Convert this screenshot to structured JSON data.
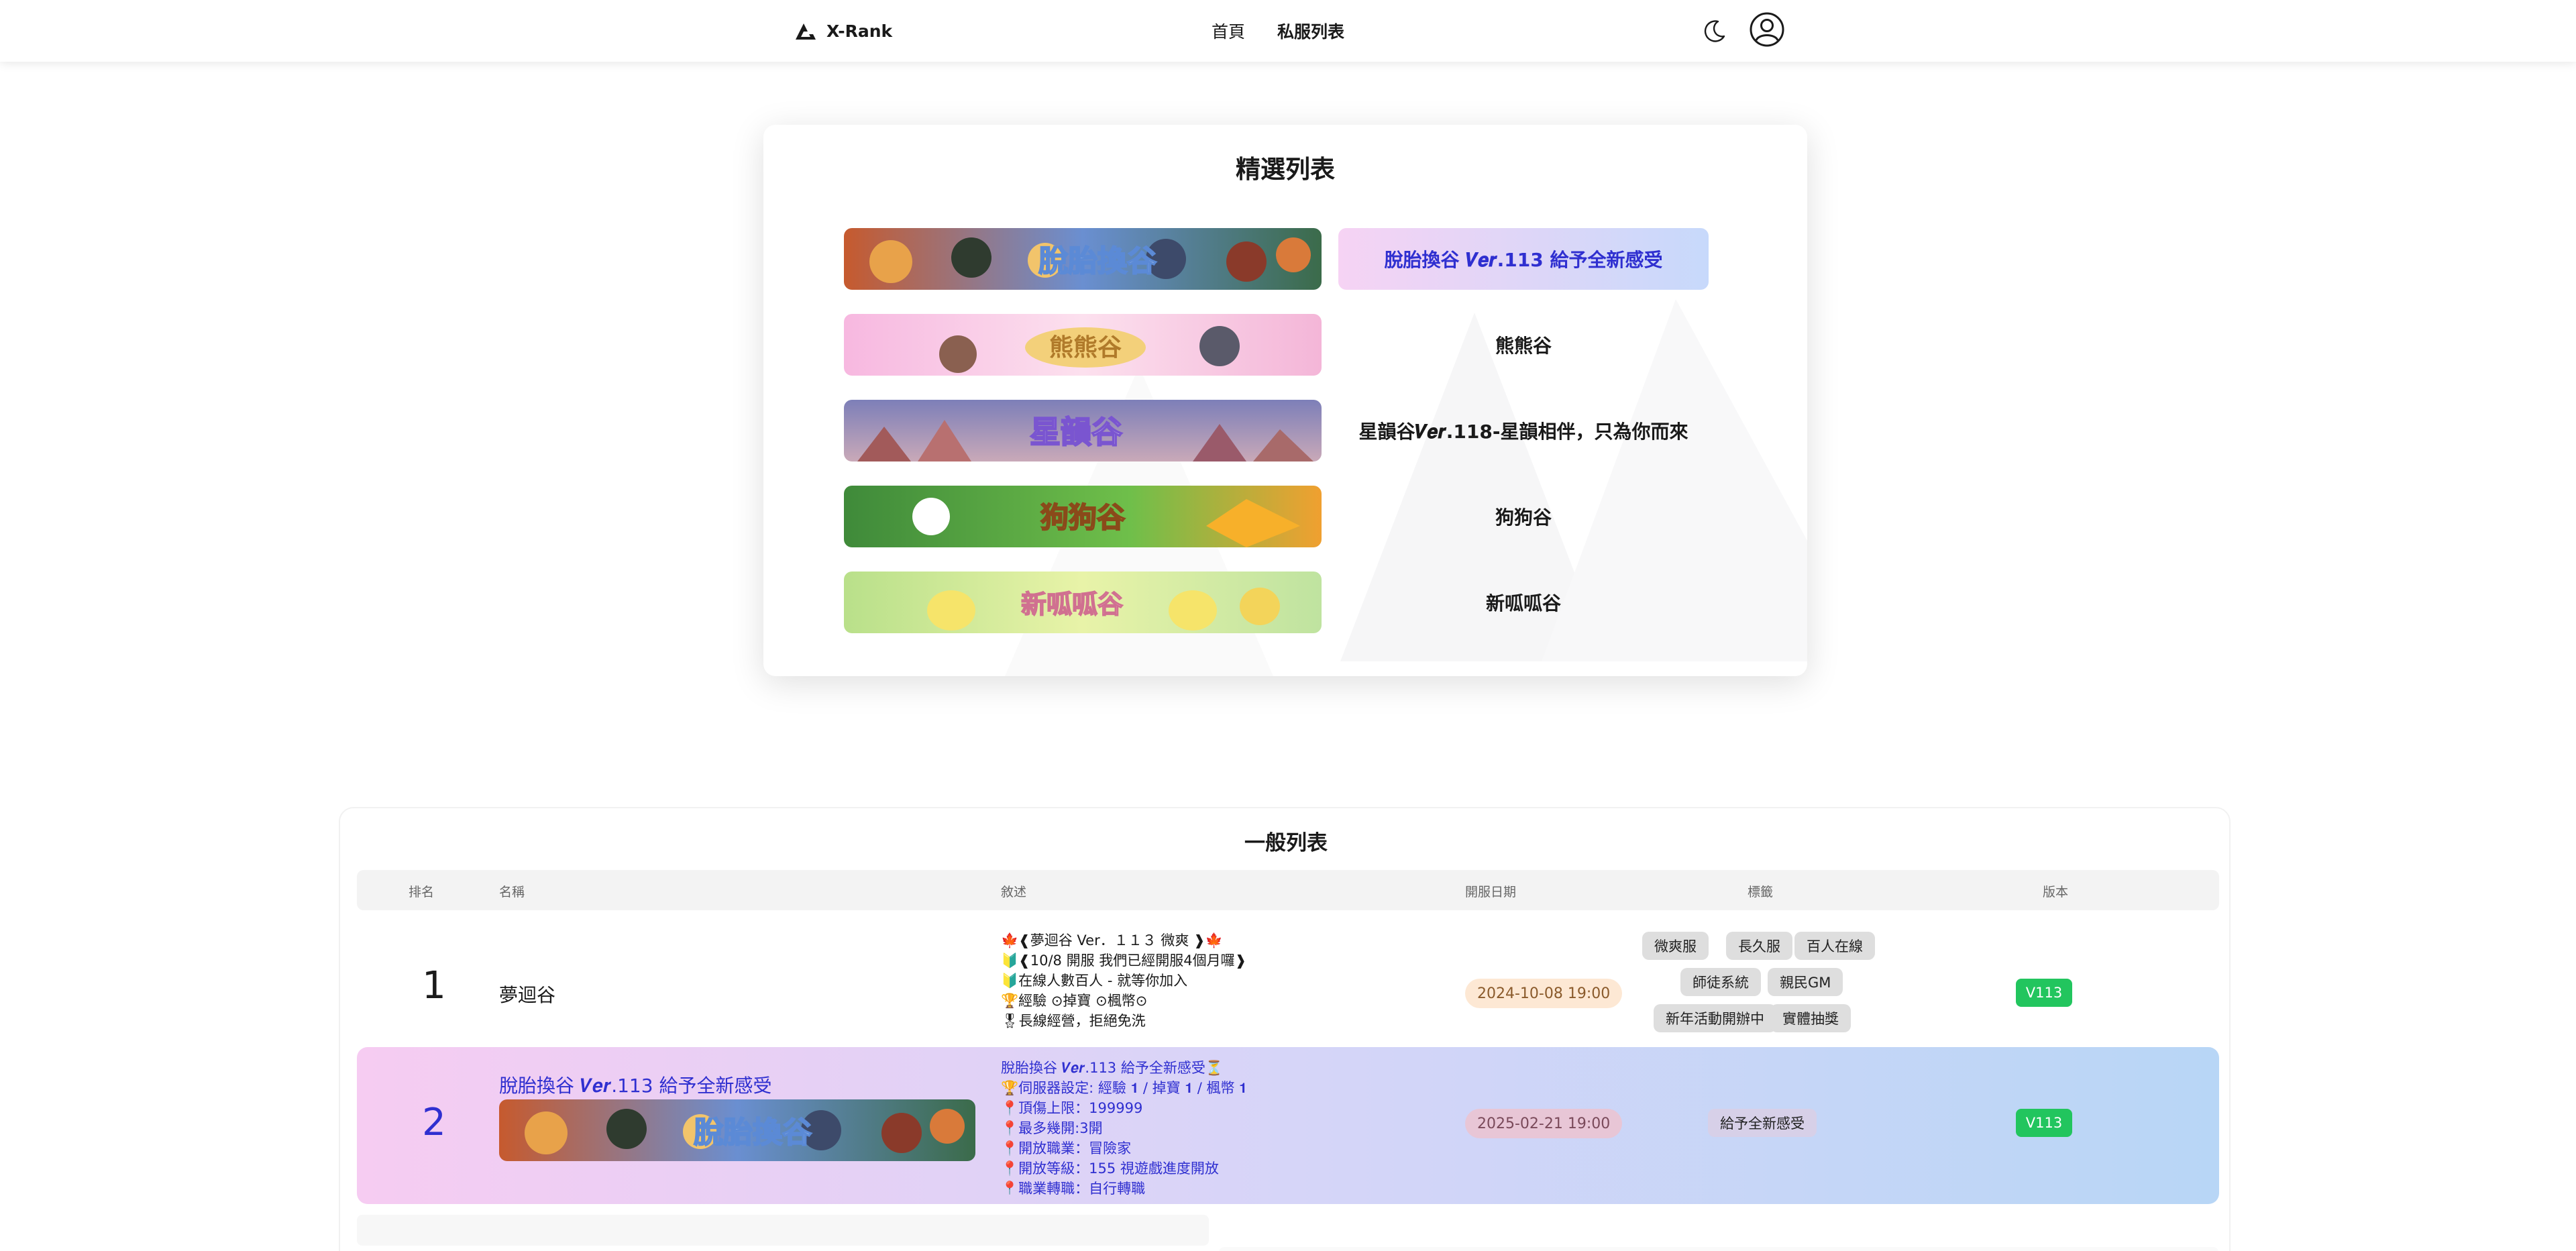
{
  "header": {
    "logo_text": "X-Rank",
    "nav": [
      {
        "label": "首頁",
        "active": false
      },
      {
        "label": "私服列表",
        "active": true
      }
    ],
    "icons": [
      "logo-icon",
      "moon-icon",
      "user-icon"
    ]
  },
  "featured": {
    "title": "精選列表",
    "items": [
      {
        "name": "脫胎換谷 𝑽𝒆𝒓.113 給予全新感受",
        "banner_text": "脫胎換谷",
        "highlight": true
      },
      {
        "name": "熊熊谷",
        "banner_text": "熊熊谷",
        "highlight": false
      },
      {
        "name": "星韻谷𝑽𝒆𝒓.118-星韻相伴，只為你而來",
        "banner_text": "星韻谷",
        "highlight": false
      },
      {
        "name": "狗狗谷",
        "banner_text": "狗狗谷",
        "highlight": false
      },
      {
        "name": "新呱呱谷",
        "banner_text": "新呱呱谷",
        "highlight": false
      }
    ]
  },
  "general": {
    "title": "一般列表",
    "columns": [
      "排名",
      "名稱",
      "敘述",
      "開服日期",
      "標籤",
      "版本"
    ],
    "rows": [
      {
        "rank": "1",
        "name": "夢迴谷",
        "desc": [
          "🍁❰夢迴谷 Ver．１１３ 微爽 ❱🍁",
          "🔰❰10/8 開服 我們已經開服4個月囉❱",
          "🔰在線人數百人 - 就等你加入",
          "🏆經驗 ⊙掉寶 ⊙楓幣⊙",
          "🎖長線經營，拒絕免洗"
        ],
        "date": "2024-10-08 19:00",
        "tags": [
          "微爽服",
          "長久服",
          "百人在線",
          "師徒系統",
          "親民GM",
          "新年活動開辦中",
          "實體抽獎"
        ],
        "version": "V113"
      },
      {
        "rank": "2",
        "name": "脫胎換谷 𝑽𝒆𝒓.113 給予全新感受",
        "banner_text": "脫胎換谷",
        "desc": [
          "脫胎換谷 𝑽𝒆𝒓.113 給予全新感受⏳",
          "🏆伺服器設定: 經驗 𝟏 / 掉寶 𝟏 / 楓幣 𝟏",
          "📍頂傷上限：199999",
          "📍最多幾開:3開",
          "📍開放職業：冒險家",
          "📍開放等級：155 視遊戲進度開放",
          "📍職業轉職：自行轉職"
        ],
        "date": "2025-02-21 19:00",
        "tags": [
          "給予全新感受"
        ],
        "version": "V113"
      }
    ]
  },
  "colors": {
    "highlight_gradient_start": "#f6d3f4",
    "highlight_gradient_end": "#c7d9fb",
    "highlight_text": "#2f2fd0",
    "version_badge": "#22c55e",
    "date_pill": "#fde8d4"
  }
}
